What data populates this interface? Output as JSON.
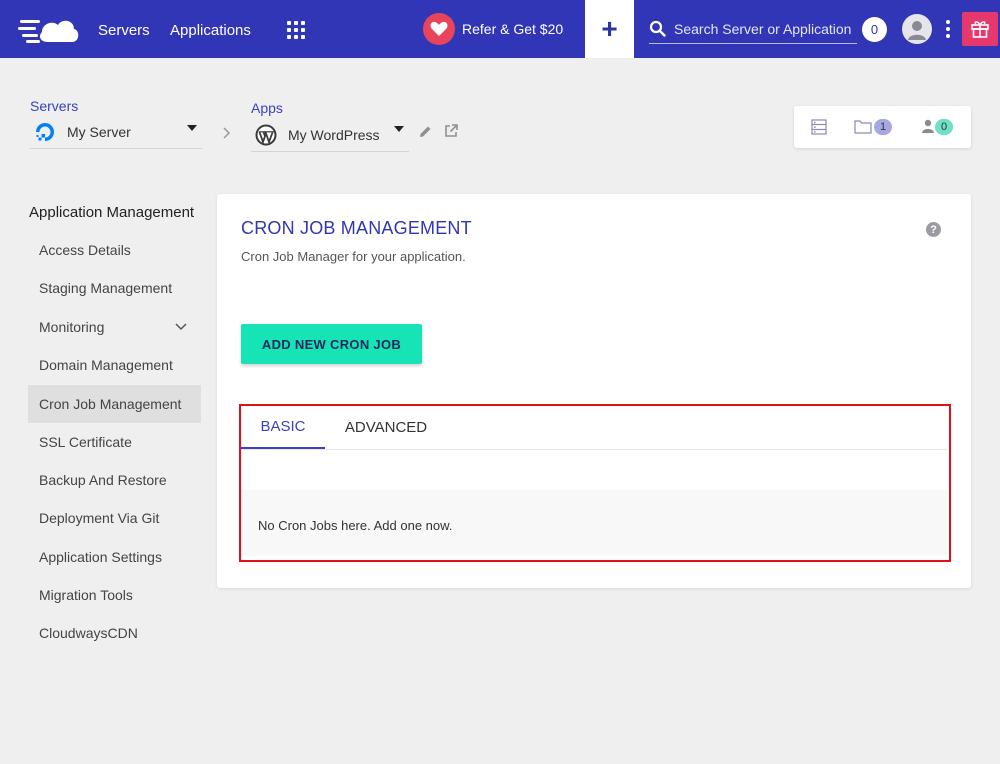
{
  "topbar": {
    "servers_label": "Servers",
    "applications_label": "Applications",
    "refer_label": "Refer & Get $20",
    "add_symbol": "+",
    "search_placeholder": "Search Server or Application",
    "notification_count": "0"
  },
  "breadcrumb": {
    "servers_label": "Servers",
    "server_name": "My Server",
    "apps_label": "Apps",
    "app_name": "My WordPress"
  },
  "stats": {
    "folders_count": "1",
    "users_count": "0"
  },
  "sidebar": {
    "title": "Application Management",
    "items": [
      {
        "label": "Access Details"
      },
      {
        "label": "Staging Management"
      },
      {
        "label": "Monitoring"
      },
      {
        "label": "Domain Management"
      },
      {
        "label": "Cron Job Management"
      },
      {
        "label": "SSL Certificate"
      },
      {
        "label": "Backup And Restore"
      },
      {
        "label": "Deployment Via Git"
      },
      {
        "label": "Application Settings"
      },
      {
        "label": "Migration Tools"
      },
      {
        "label": "CloudwaysCDN"
      }
    ],
    "active_item": "Cron Job Management"
  },
  "main": {
    "title": "CRON JOB MANAGEMENT",
    "subtitle": "Cron Job Manager for your application.",
    "help_symbol": "?",
    "add_button_label": "ADD NEW CRON JOB",
    "tabs": [
      {
        "label": "BASIC"
      },
      {
        "label": "ADVANCED"
      }
    ],
    "active_tab": "BASIC",
    "empty_message": "No Cron Jobs here. Add one now."
  },
  "icons": {
    "logo": "cloudways-logo-icon",
    "apps": "apps-grid-icon",
    "refer": "heart-icon",
    "search": "search-icon",
    "user": "user-avatar-icon",
    "more": "kebab-menu-icon",
    "gift": "gift-icon",
    "server_provider": "digitalocean-icon",
    "app_type": "wordpress-icon",
    "edit": "pencil-icon",
    "external": "external-link-icon"
  },
  "colors": {
    "topbar": "#3136b6",
    "accent": "#3941c4",
    "button": "#17e4b6",
    "refer_heart": "#e8445b",
    "gift": "#e6386d",
    "highlight": "#e0101a"
  }
}
